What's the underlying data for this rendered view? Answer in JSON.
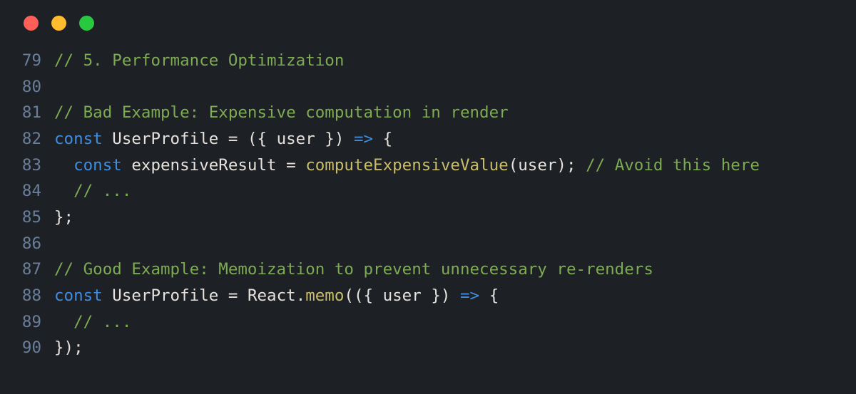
{
  "window": {
    "traffic_light_red": "#ff5f56",
    "traffic_light_yellow": "#ffbd2e",
    "traffic_light_green": "#27c93f"
  },
  "lines": [
    {
      "num": "79",
      "tokens": [
        {
          "cls": "c-comment",
          "t": "// 5. Performance Optimization"
        }
      ]
    },
    {
      "num": "80",
      "tokens": []
    },
    {
      "num": "81",
      "tokens": [
        {
          "cls": "c-comment",
          "t": "// Bad Example: Expensive computation in render"
        }
      ]
    },
    {
      "num": "82",
      "tokens": [
        {
          "cls": "c-keyword",
          "t": "const"
        },
        {
          "cls": "c-ident",
          "t": " UserProfile "
        },
        {
          "cls": "c-punct",
          "t": "= "
        },
        {
          "cls": "c-punct",
          "t": "({ "
        },
        {
          "cls": "c-param",
          "t": "user"
        },
        {
          "cls": "c-punct",
          "t": " }) "
        },
        {
          "cls": "c-arrow",
          "t": "=>"
        },
        {
          "cls": "c-punct",
          "t": " {"
        }
      ]
    },
    {
      "num": "83",
      "tokens": [
        {
          "cls": "c-ident",
          "t": "  "
        },
        {
          "cls": "c-keyword",
          "t": "const"
        },
        {
          "cls": "c-ident",
          "t": " expensiveResult "
        },
        {
          "cls": "c-punct",
          "t": "= "
        },
        {
          "cls": "c-func",
          "t": "computeExpensiveValue"
        },
        {
          "cls": "c-punct",
          "t": "(user); "
        },
        {
          "cls": "c-comment",
          "t": "// Avoid this here"
        }
      ]
    },
    {
      "num": "84",
      "tokens": [
        {
          "cls": "c-ident",
          "t": "  "
        },
        {
          "cls": "c-comment",
          "t": "// ..."
        }
      ]
    },
    {
      "num": "85",
      "tokens": [
        {
          "cls": "c-punct",
          "t": "};"
        }
      ]
    },
    {
      "num": "86",
      "tokens": []
    },
    {
      "num": "87",
      "tokens": [
        {
          "cls": "c-comment",
          "t": "// Good Example: Memoization to prevent unnecessary re-renders"
        }
      ]
    },
    {
      "num": "88",
      "tokens": [
        {
          "cls": "c-keyword",
          "t": "const"
        },
        {
          "cls": "c-ident",
          "t": " UserProfile "
        },
        {
          "cls": "c-punct",
          "t": "= "
        },
        {
          "cls": "c-ident",
          "t": "React"
        },
        {
          "cls": "c-punct",
          "t": "."
        },
        {
          "cls": "c-func",
          "t": "memo"
        },
        {
          "cls": "c-punct",
          "t": "(({ "
        },
        {
          "cls": "c-param",
          "t": "user"
        },
        {
          "cls": "c-punct",
          "t": " }) "
        },
        {
          "cls": "c-arrow",
          "t": "=>"
        },
        {
          "cls": "c-punct",
          "t": " {"
        }
      ]
    },
    {
      "num": "89",
      "tokens": [
        {
          "cls": "c-ident",
          "t": "  "
        },
        {
          "cls": "c-comment",
          "t": "// ..."
        }
      ]
    },
    {
      "num": "90",
      "tokens": [
        {
          "cls": "c-punct",
          "t": "});"
        }
      ]
    }
  ]
}
